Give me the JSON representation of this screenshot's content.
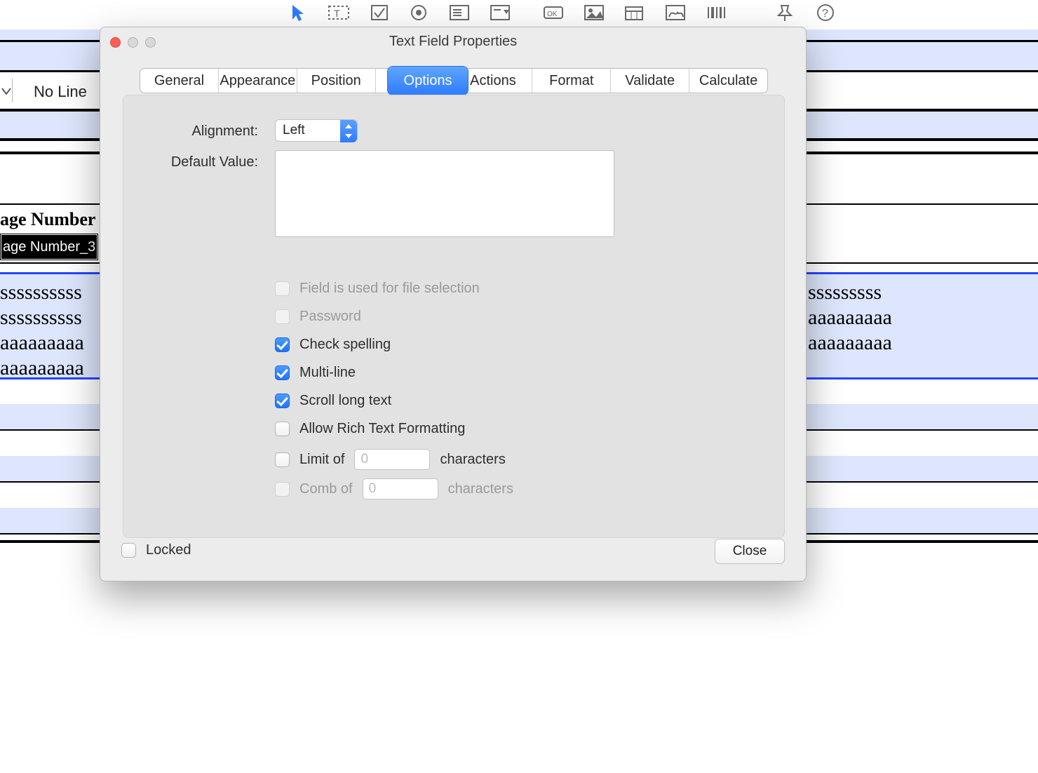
{
  "toolbar": {
    "noline_label": "No Line"
  },
  "document": {
    "header": "age Number",
    "field_name": "age Number_3",
    "line1_left": "ssssssssss",
    "line2_left": "ssssssssss",
    "line3_left": "aaaaaaaaa",
    "line4_left": "aaaaaaaaa",
    "line1_right": "sssssssss",
    "line2_right": "aaaaaaaaa",
    "line3_right": "aaaaaaaaa"
  },
  "dialog": {
    "title": "Text Field Properties",
    "tabs": [
      "General",
      "Appearance",
      "Position",
      "Options",
      "Actions",
      "Format",
      "Validate",
      "Calculate"
    ],
    "options": {
      "alignment_label": "Alignment:",
      "alignment_value": "Left",
      "default_value_label": "Default Value:",
      "default_value": "",
      "field_file_selection": "Field is used for file selection",
      "password": "Password",
      "check_spelling": "Check spelling",
      "multi_line": "Multi-line",
      "scroll_long_text": "Scroll long text",
      "allow_rtf": "Allow Rich Text Formatting",
      "limit_of": "Limit of",
      "limit_value": "0",
      "comb_of": "Comb of",
      "comb_value": "0",
      "characters": "characters"
    },
    "locked_label": "Locked",
    "close_label": "Close"
  }
}
